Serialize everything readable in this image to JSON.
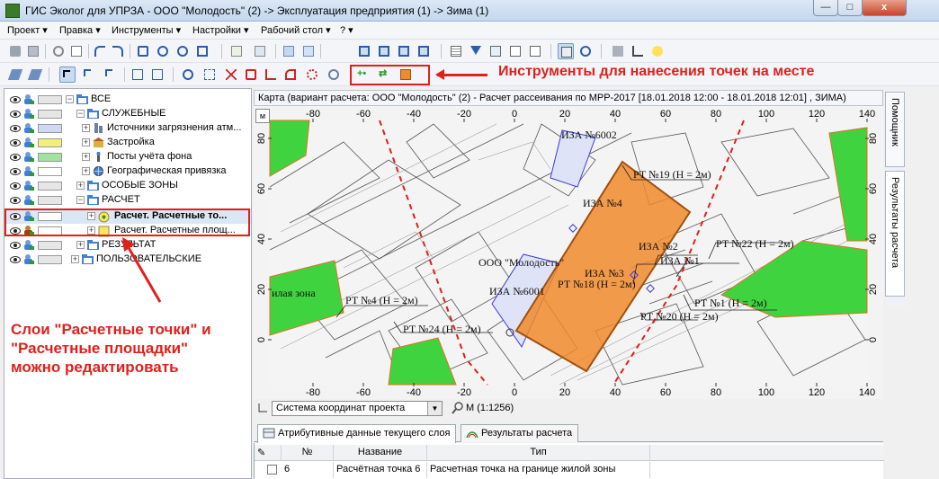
{
  "window": {
    "title": "ГИС Эколог для УПРЗА - ООО \"Молодость\" (2) -> Эксплуатация предприятия (1) -> Зима (1)",
    "close_label": "x"
  },
  "menu": [
    "Проект ▾",
    "Правка ▾",
    "Инструменты ▾",
    "Настройки ▾",
    "Рабочий стол ▾",
    "? ▾"
  ],
  "annotations": {
    "tools_note": "Инструменты для нанесения точек на месте",
    "layers_note_1": "Слои \"Расчетные точки\" и",
    "layers_note_2": "\"Расчетные площадки\"",
    "layers_note_3": "можно редактировать"
  },
  "layer_tree": {
    "items": [
      {
        "label": "ВСЕ",
        "swatch": "#e6e6e6"
      },
      {
        "label": "СЛУЖЕБНЫЕ",
        "swatch": "#e6e6e6"
      },
      {
        "label": "Источники загрязнения атм...",
        "swatch": "#cfd8f5"
      },
      {
        "label": "Застройка",
        "swatch": "#f2f07a"
      },
      {
        "label": "Посты учёта фона",
        "swatch": "#9fe39f"
      },
      {
        "label": "Географическая привязка",
        "swatch": "#ffffff"
      },
      {
        "label": "ОСОБЫЕ ЗОНЫ",
        "swatch": "#e6e6e6"
      },
      {
        "label": "РАСЧЕТ",
        "swatch": "#e6e6e6"
      },
      {
        "label": "Расчет. Расчетные то...",
        "swatch": "#ffffff"
      },
      {
        "label": "Расчет. Расчетные площ...",
        "swatch": "#ffffff"
      },
      {
        "label": "РЕЗУЛЬТАТ",
        "swatch": "#e6e6e6"
      },
      {
        "label": "ПОЛЬЗОВАТЕЛЬСКИЕ",
        "swatch": "#e6e6e6"
      }
    ]
  },
  "map": {
    "header": "Карта (вариант расчета: ООО \"Молодость\" (2) - Расчет рассеивания по МРР-2017 [18.01.2018 12:00 - 18.01.2018 12:01] , ЗИМА)",
    "corner_button": "м",
    "x_ticks": [
      "-80",
      "-60",
      "-40",
      "-20",
      "0",
      "20",
      "40",
      "60",
      "80",
      "100",
      "120",
      "140"
    ],
    "y_ticks": [
      "80",
      "60",
      "40",
      "20",
      "0"
    ],
    "labels": {
      "iza6002": "ИЗА №6002",
      "iza4": "ИЗА №4",
      "iza2": "ИЗА №2",
      "iza1": "ИЗА №1",
      "iza3": "ИЗА №3",
      "iza6001": "ИЗА №6001",
      "company": "ООО \"Молодость\"",
      "rt19": "РТ №19 (Н = 2м)",
      "rt22": "РТ №22 (Н = 2м)",
      "rt18": "РТ №18 (Н = 2м)",
      "rt1": "РТ №1 (Н = 2м)",
      "rt20": "РТ №20 (Н = 2м)",
      "rt4": "РТ №4 (Н = 2м)",
      "rt24": "РТ №24 (Н = 2м)",
      "zone": "илая зона"
    }
  },
  "side_tabs": [
    "Помощник",
    "Результаты расчета"
  ],
  "coords": {
    "system": "Система координат проекта",
    "scale": "М (1:1256)"
  },
  "bottom_tabs": [
    "Атрибутивные данные текущего слоя",
    "Результаты расчета"
  ],
  "table": {
    "headers": [
      "№",
      "Название",
      "Тип"
    ],
    "rows": [
      {
        "num": "6",
        "name": "Расчётная точка 6",
        "type": "Расчетная точка на границе жилой зоны"
      }
    ]
  },
  "colors": {
    "accent_red": "#e0201a",
    "source_orange": "#f08a2a",
    "green_zone": "#3fd43f"
  }
}
